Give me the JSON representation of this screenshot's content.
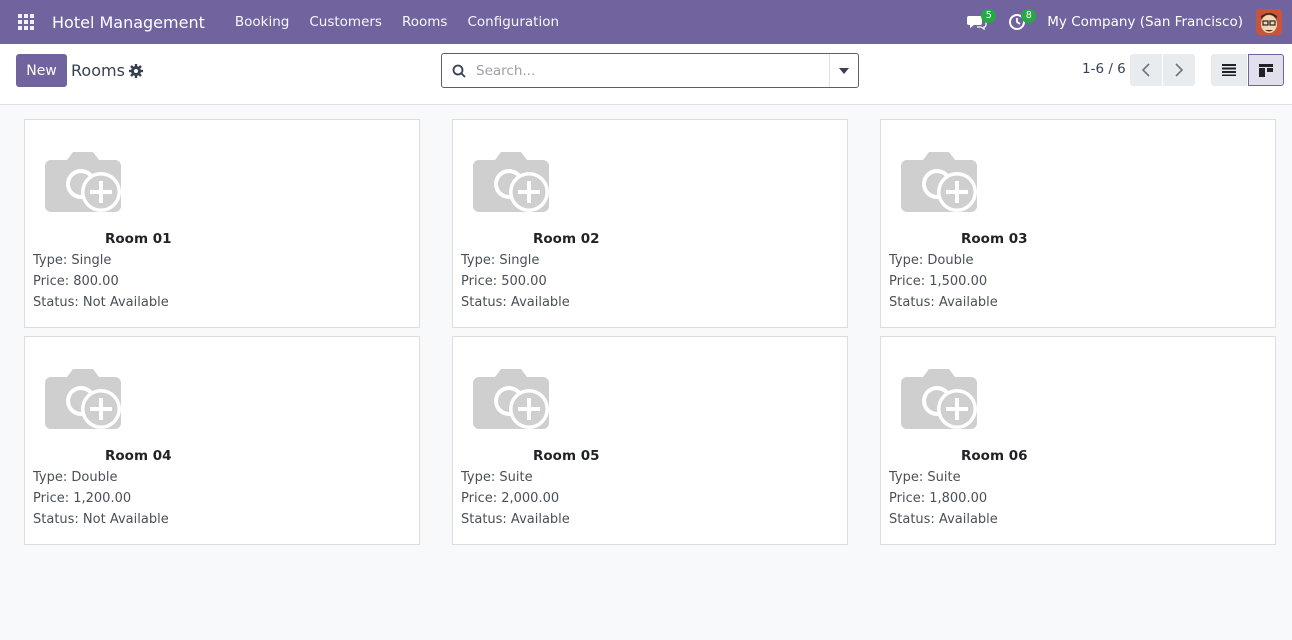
{
  "topbar": {
    "brand": "Hotel Management",
    "menu": [
      "Booking",
      "Customers",
      "Rooms",
      "Configuration"
    ],
    "messages_count": "5",
    "activities_count": "8",
    "company": "My Company (San Francisco)"
  },
  "control_panel": {
    "new_label": "New",
    "breadcrumb": "Rooms",
    "search_placeholder": "Search...",
    "pager": "1-6 / 6"
  },
  "rooms": [
    {
      "name": "Room 01",
      "type": "Type: Single",
      "price": "Price: 800.00",
      "status": "Status: Not Available"
    },
    {
      "name": "Room 02",
      "type": "Type: Single",
      "price": "Price: 500.00",
      "status": "Status: Available"
    },
    {
      "name": "Room 03",
      "type": "Type: Double",
      "price": "Price: 1,500.00",
      "status": "Status: Available"
    },
    {
      "name": "Room 04",
      "type": "Type: Double",
      "price": "Price: 1,200.00",
      "status": "Status: Not Available"
    },
    {
      "name": "Room 05",
      "type": "Type: Suite",
      "price": "Price: 2,000.00",
      "status": "Status: Available"
    },
    {
      "name": "Room 06",
      "type": "Type: Suite",
      "price": "Price: 1,800.00",
      "status": "Status: Available"
    }
  ],
  "colors": {
    "brand": "#71639e",
    "badge": "#28a745"
  }
}
